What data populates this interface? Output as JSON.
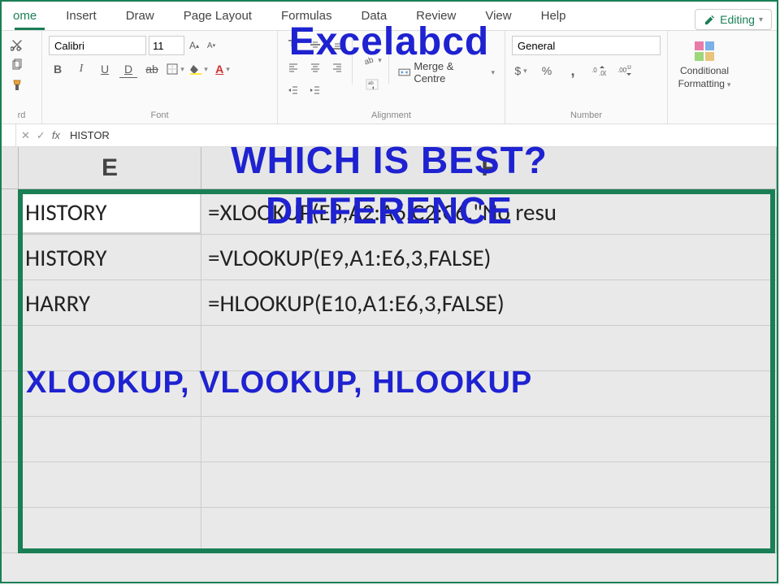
{
  "tabs": {
    "home": "ome",
    "insert": "Insert",
    "draw": "Draw",
    "pagelayout": "Page Layout",
    "formulas": "Formulas",
    "data": "Data",
    "review": "Review",
    "view": "View",
    "help": "Help"
  },
  "editing_btn": "Editing",
  "ribbon": {
    "clipboard_label": "rd",
    "font_label": "Font",
    "alignment_label": "Alignment",
    "number_label": "Number",
    "font_name": "Calibri",
    "font_size": "11",
    "merge_label": "Merge & Centre",
    "number_format": "General",
    "conditional": "Conditional",
    "formatting": "Formatting",
    "currency": "$",
    "percent": "%",
    "comma": ","
  },
  "formula_bar": {
    "value": "HISTOR"
  },
  "columns": {
    "E": "E",
    "F": "F"
  },
  "rows": [
    {
      "e": "HISTORY",
      "f": "=XLOOKUP(E8,A2:A6,C2:C6,\"No resu",
      "active": true
    },
    {
      "e": "HISTORY",
      "f": "=VLOOKUP(E9,A1:E6,3,FALSE)",
      "active": false
    },
    {
      "e": "HARRY",
      "f": "=HLOOKUP(E10,A1:E6,3,FALSE)",
      "active": false
    },
    {
      "e": "",
      "f": "",
      "active": false
    },
    {
      "e": "",
      "f": "",
      "active": false
    },
    {
      "e": "",
      "f": "",
      "active": false
    },
    {
      "e": "",
      "f": "",
      "active": false
    },
    {
      "e": "",
      "f": "",
      "active": false
    }
  ],
  "overlay": {
    "title": "Excelabcd",
    "which": "WHICH IS BEST?",
    "diff": "DIFFERENCE",
    "lookups": "XLOOKUP, VLOOKUP, HLOOKUP"
  }
}
